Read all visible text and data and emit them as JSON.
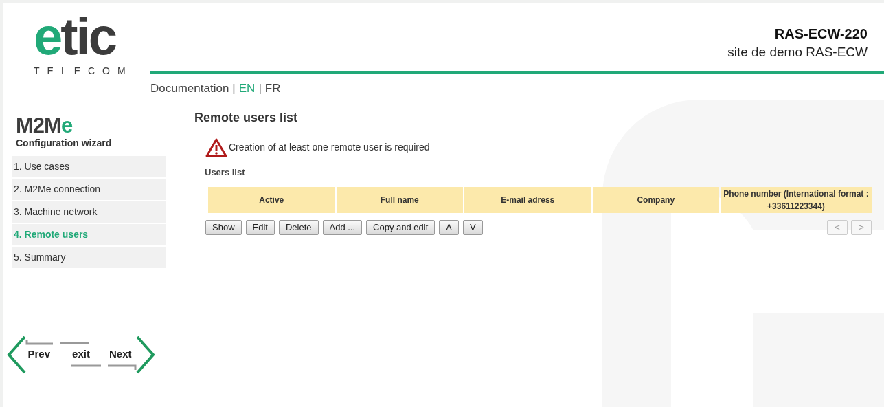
{
  "logo": {
    "mark": "etic",
    "tagline": "TELECOM"
  },
  "header": {
    "device": "RAS-ECW-220",
    "site": "site de demo RAS-ECW"
  },
  "top_links": [
    {
      "label": "Documentation",
      "selected": false
    },
    {
      "separator": "|",
      "label": "EN",
      "selected": true
    },
    {
      "separator": "|",
      "label": "FR",
      "selected": false
    }
  ],
  "wizard": {
    "brand": "M2Me",
    "subtitle": "Configuration wizard"
  },
  "steps": [
    {
      "label": "1. Use cases",
      "selected": false
    },
    {
      "label": "2. M2Me connection",
      "selected": false
    },
    {
      "label": "3. Machine network",
      "selected": false
    },
    {
      "label": "4. Remote users",
      "selected": true
    },
    {
      "label": "5. Summary",
      "selected": false
    }
  ],
  "nav": {
    "prev": "Prev",
    "exit": "exit",
    "next": "Next"
  },
  "page_title": "Remote users list",
  "warning": "Creation of at least one remote user is required",
  "table": {
    "title": "Users list",
    "columns": [
      "Active",
      "Full name",
      "E-mail adress",
      "Company",
      "Phone number (International format : +33611223344)"
    ]
  },
  "actions": [
    "Show",
    "Edit",
    "Delete",
    "Add ...",
    "Copy and edit",
    "Λ",
    "V"
  ],
  "pager": [
    {
      "label": "<",
      "disabled": true
    },
    {
      "label": ">",
      "disabled": true
    }
  ]
}
